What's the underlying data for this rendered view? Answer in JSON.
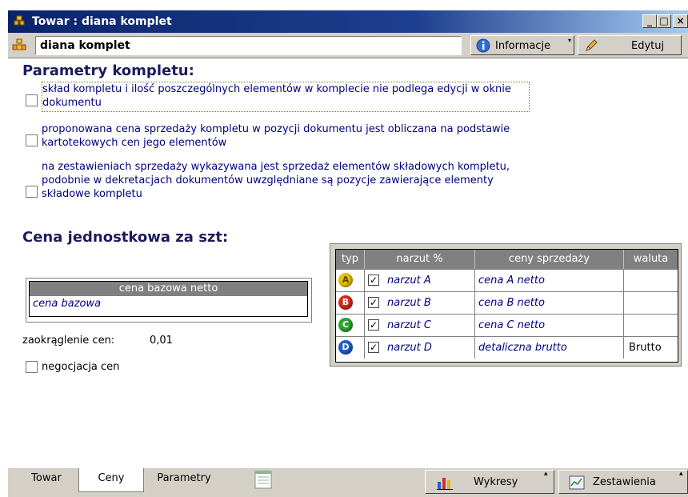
{
  "window": {
    "title": "Towar : diana komplet",
    "controls": [
      "minimize",
      "maximize",
      "close"
    ]
  },
  "header": {
    "name": "diana komplet",
    "info_button": "Informacje",
    "edit_button": "Edytuj"
  },
  "params": {
    "title": "Parametry kompletu:",
    "options": [
      {
        "label": "skład kompletu i ilość poszczególnych elementów w komplecie nie podlega edycji w oknie dokumentu",
        "checked": false
      },
      {
        "label": "proponowana cena sprzedaży kompletu w pozycji dokumentu jest obliczana na podstawie kartotekowych cen jego elementów",
        "checked": false
      },
      {
        "label": "na zestawieniach sprzedaży wykazywana jest sprzedaż elementów składowych kompletu, podobnie w dekretacjach dokumentów uwzględniane są pozycje zawierające elementy składowe kompletu",
        "checked": false
      }
    ]
  },
  "price": {
    "title": "Cena jednostkowa za szt:",
    "base_header": "cena bazowa netto",
    "base_value": "cena bazowa",
    "rounding_label": "zaokrąglenie cen:",
    "rounding_value": "0,01",
    "negotiation_label": "negocjacja cen"
  },
  "price_table": {
    "headers": [
      "typ",
      "narzut %",
      "ceny sprzedaży",
      "waluta"
    ],
    "rows": [
      {
        "type": "A",
        "color": "#e8c000",
        "checked": true,
        "markup": "narzut A",
        "price": "cena A netto",
        "currency": ""
      },
      {
        "type": "B",
        "color": "#d62a1e",
        "checked": true,
        "markup": "narzut B",
        "price": "cena B netto",
        "currency": ""
      },
      {
        "type": "C",
        "color": "#2fa52f",
        "checked": true,
        "markup": "narzut C",
        "price": "cena C netto",
        "currency": ""
      },
      {
        "type": "D",
        "color": "#1f5fc8",
        "checked": true,
        "markup": "narzut D",
        "price": "detaliczna brutto",
        "currency": "Brutto"
      }
    ]
  },
  "tabs": [
    "Towar",
    "Ceny",
    "Parametry"
  ],
  "active_tab": "Ceny",
  "bottom_buttons": {
    "charts": "Wykresy",
    "reports": "Zestawienia"
  }
}
